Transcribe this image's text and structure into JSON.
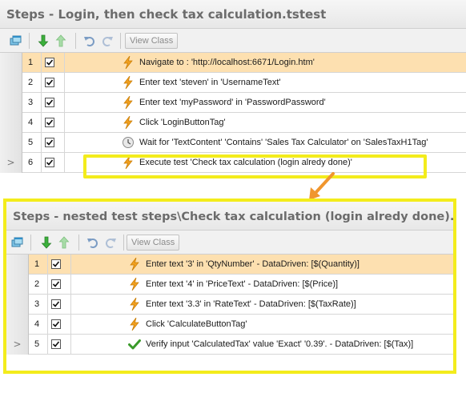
{
  "panel1": {
    "title": "Steps - Login, then check tax calculation.tstest",
    "toolbar": {
      "view_class_label": "View Class"
    },
    "rows": [
      {
        "n": "1",
        "marker": "",
        "checked": true,
        "icon": "lightning-icon",
        "text": "Navigate to : 'http://localhost:6671/Login.htm'",
        "selected": true
      },
      {
        "n": "2",
        "marker": "",
        "checked": true,
        "icon": "lightning-icon",
        "text": "Enter text 'steven' in 'UsernameText'",
        "selected": false
      },
      {
        "n": "3",
        "marker": "",
        "checked": true,
        "icon": "lightning-icon",
        "text": "Enter text 'myPassword' in 'PasswordPassword'",
        "selected": false
      },
      {
        "n": "4",
        "marker": "",
        "checked": true,
        "icon": "lightning-icon",
        "text": "Click 'LoginButtonTag'",
        "selected": false
      },
      {
        "n": "5",
        "marker": "",
        "checked": true,
        "icon": "clock-icon",
        "text": "Wait for 'TextContent' 'Contains' 'Sales Tax Calculator' on 'SalesTaxH1Tag'",
        "selected": false
      },
      {
        "n": "6",
        "marker": ">",
        "checked": true,
        "icon": "lightning-icon",
        "text": "Execute test 'Check tax calculation (login alredy done)'",
        "selected": false
      }
    ]
  },
  "panel2": {
    "title": "Steps - nested test steps\\Check tax calculation (login alredy done).tstest",
    "toolbar": {
      "view_class_label": "View Class"
    },
    "rows": [
      {
        "n": "1",
        "marker": "",
        "checked": true,
        "icon": "lightning-icon",
        "text": "Enter text '3' in 'QtyNumber' - DataDriven: [$(Quantity)]",
        "selected": true
      },
      {
        "n": "2",
        "marker": "",
        "checked": true,
        "icon": "lightning-icon",
        "text": "Enter text '4' in 'PriceText' - DataDriven: [$(Price)]",
        "selected": false
      },
      {
        "n": "3",
        "marker": "",
        "checked": true,
        "icon": "lightning-icon",
        "text": "Enter text '3.3' in 'RateText' - DataDriven: [$(TaxRate)]",
        "selected": false
      },
      {
        "n": "4",
        "marker": "",
        "checked": true,
        "icon": "lightning-icon",
        "text": "Click 'CalculateButtonTag'",
        "selected": false
      },
      {
        "n": "5",
        "marker": ">",
        "checked": true,
        "icon": "checkmark-icon",
        "text": "Verify input 'CalculatedTax' value 'Exact' '0.39'. - DataDriven: [$(Tax)]",
        "selected": false
      }
    ]
  },
  "colors": {
    "highlight_border": "#f3ec1c",
    "selected_row": "#fde0b0",
    "arrow": "#f0962e",
    "lightning": "#f0a020",
    "checkmark": "#3a9a2a"
  }
}
